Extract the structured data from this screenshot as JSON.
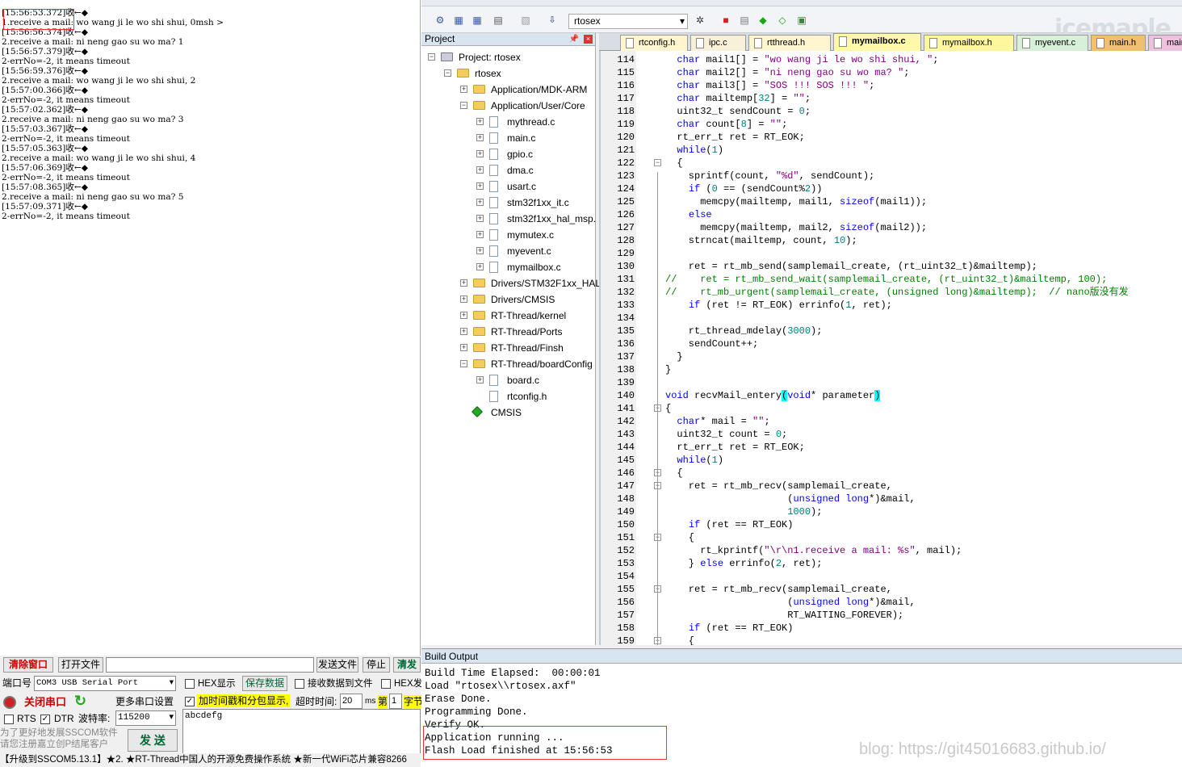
{
  "sscom": {
    "recv_lines": [
      "[15:56:53.372]收←◆",
      "1.receive a mail: wo wang ji le wo shi shui, 0msh >",
      "[15:56:56.374]收←◆",
      "2.receive a mail: ni neng gao su wo ma? 1",
      "[15:56:57.379]收←◆",
      "2-errNo=-2, it means timeout",
      "[15:56:59.376]收←◆",
      "2.receive a mail: wo wang ji le wo shi shui, 2",
      "[15:57:00.366]收←◆",
      "2-errNo=-2, it means timeout",
      "[15:57:02.362]收←◆",
      "2.receive a mail: ni neng gao su wo ma? 3",
      "[15:57:03.367]收←◆",
      "2-errNo=-2, it means timeout",
      "[15:57:05.363]收←◆",
      "2.receive a mail: wo wang ji le wo shi shui, 4",
      "[15:57:06.369]收←◆",
      "2-errNo=-2, it means timeout",
      "[15:57:08.365]收←◆",
      "2.receive a mail: ni neng gao su wo ma? 5",
      "[15:57:09.371]收←◆",
      "2-errNo=-2, it means timeout"
    ],
    "clear_btn": "清除窗口",
    "open_file_btn": "打开文件",
    "send_file_btn": "发送文件",
    "stop_btn": "停止",
    "clear_send_btn": "清发",
    "port_label": "端口号",
    "port_value": "COM3 USB Serial Port",
    "hex_show": "HEX显示",
    "save_data": "保存数据",
    "recv_to_file": "接收数据到文件",
    "hex_send": "HEX发",
    "close_port": "关闭串口",
    "more_settings": "更多串口设置",
    "timestamp_opt": "加时间戳和分包显示,",
    "timeout_label": "超时时间:",
    "timeout_value": "20",
    "timeout_unit": "ms",
    "nth_label": "第",
    "nth_value": "1",
    "byte_label": "字节",
    "rts": "RTS",
    "dtr": "DTR",
    "baud_label": "波特率:",
    "baud_value": "115200",
    "send_text": "abcdefg",
    "promo1": "为了更好地发展SSCOM软件",
    "promo2": "请您注册嘉立创P结尾客户",
    "send_btn": "发 送",
    "ticker": "【升级到SSCOM5.13.1】★2. ★RT-Thread中国人的开源免费操作系统 ★新一代WiFi芯片兼容8266"
  },
  "keil": {
    "target": "rtosex",
    "brand": "icemaple",
    "project_title": "Project",
    "tree": [
      {
        "label": "Project: rtosex",
        "level": 0,
        "kind": "root"
      },
      {
        "label": "rtosex",
        "level": 1,
        "kind": "target"
      },
      {
        "label": "Application/MDK-ARM",
        "level": 2,
        "kind": "folder",
        "state": "+"
      },
      {
        "label": "Application/User/Core",
        "level": 2,
        "kind": "folder",
        "state": "-"
      },
      {
        "label": "mythread.c",
        "level": 3,
        "kind": "file",
        "state": "+"
      },
      {
        "label": "main.c",
        "level": 3,
        "kind": "file",
        "state": "+"
      },
      {
        "label": "gpio.c",
        "level": 3,
        "kind": "file",
        "state": "+"
      },
      {
        "label": "dma.c",
        "level": 3,
        "kind": "file",
        "state": "+"
      },
      {
        "label": "usart.c",
        "level": 3,
        "kind": "file",
        "state": "+"
      },
      {
        "label": "stm32f1xx_it.c",
        "level": 3,
        "kind": "file",
        "state": "+"
      },
      {
        "label": "stm32f1xx_hal_msp.",
        "level": 3,
        "kind": "file",
        "state": "+"
      },
      {
        "label": "mymutex.c",
        "level": 3,
        "kind": "file",
        "state": "+"
      },
      {
        "label": "myevent.c",
        "level": 3,
        "kind": "file",
        "state": "+"
      },
      {
        "label": "mymailbox.c",
        "level": 3,
        "kind": "file",
        "state": "+"
      },
      {
        "label": "Drivers/STM32F1xx_HAL",
        "level": 2,
        "kind": "folder",
        "state": "+"
      },
      {
        "label": "Drivers/CMSIS",
        "level": 2,
        "kind": "folder",
        "state": "+"
      },
      {
        "label": "RT-Thread/kernel",
        "level": 2,
        "kind": "folder",
        "state": "+"
      },
      {
        "label": "RT-Thread/Ports",
        "level": 2,
        "kind": "folder",
        "state": "+"
      },
      {
        "label": "RT-Thread/Finsh",
        "level": 2,
        "kind": "folder",
        "state": "+"
      },
      {
        "label": "RT-Thread/boardConfig",
        "level": 2,
        "kind": "folder",
        "state": "-"
      },
      {
        "label": "board.c",
        "level": 3,
        "kind": "file",
        "state": "+"
      },
      {
        "label": "rtconfig.h",
        "level": 3,
        "kind": "file",
        "state": ""
      },
      {
        "label": "CMSIS",
        "level": 2,
        "kind": "component",
        "state": ""
      }
    ],
    "tabs": [
      {
        "label": "rtconfig.h",
        "color": "#fff6d0",
        "active": false
      },
      {
        "label": "ipc.c",
        "color": "#f8f0d8",
        "active": false
      },
      {
        "label": "rtthread.h",
        "color": "#fff6d0",
        "active": false
      },
      {
        "label": "mymailbox.c",
        "color": "#fff8a8",
        "active": true
      },
      {
        "label": "mymailbox.h",
        "color": "#fff6a0",
        "active": false
      },
      {
        "label": "myevent.c",
        "color": "#d8f0d8",
        "active": false
      },
      {
        "label": "main.h",
        "color": "#f0c070",
        "active": false
      },
      {
        "label": "main.c",
        "color": "#f0c0e0",
        "active": false
      }
    ],
    "code_lines": [
      {
        "n": "114",
        "t": "  char mail1[] = \"wo wang ji le wo shi shui, \";"
      },
      {
        "n": "115",
        "t": "  char mail2[] = \"ni neng gao su wo ma? \";"
      },
      {
        "n": "116",
        "t": "  char mail3[] = \"SOS !!! SOS !!! \";"
      },
      {
        "n": "117",
        "t": "  char mailtemp[32] = \"\";"
      },
      {
        "n": "118",
        "t": "  uint32_t sendCount = 0;"
      },
      {
        "n": "119",
        "t": "  char count[8] = \"\";"
      },
      {
        "n": "120",
        "t": "  rt_err_t ret = RT_EOK;"
      },
      {
        "n": "121",
        "t": "  while(1)"
      },
      {
        "n": "122",
        "t": "  {"
      },
      {
        "n": "123",
        "t": "    sprintf(count, \"%d\", sendCount);"
      },
      {
        "n": "124",
        "t": "    if (0 == (sendCount%2))"
      },
      {
        "n": "125",
        "t": "      memcpy(mailtemp, mail1, sizeof(mail1));"
      },
      {
        "n": "126",
        "t": "    else"
      },
      {
        "n": "127",
        "t": "      memcpy(mailtemp, mail2, sizeof(mail2));"
      },
      {
        "n": "128",
        "t": "    strncat(mailtemp, count, 10);"
      },
      {
        "n": "129",
        "t": ""
      },
      {
        "n": "130",
        "t": "    ret = rt_mb_send(samplemail_create, (rt_uint32_t)&mailtemp);"
      },
      {
        "n": "131",
        "t": "//    ret = rt_mb_send_wait(samplemail_create, (rt_uint32_t)&mailtemp, 100);"
      },
      {
        "n": "132",
        "t": "//    rt_mb_urgent(samplemail_create, (unsigned long)&mailtemp);  // nano版没有发"
      },
      {
        "n": "133",
        "t": "    if (ret != RT_EOK) errinfo(1, ret);"
      },
      {
        "n": "134",
        "t": ""
      },
      {
        "n": "135",
        "t": "    rt_thread_mdelay(3000);"
      },
      {
        "n": "136",
        "t": "    sendCount++;"
      },
      {
        "n": "137",
        "t": "  }"
      },
      {
        "n": "138",
        "t": "}"
      },
      {
        "n": "139",
        "t": ""
      },
      {
        "n": "140",
        "t": "void recvMail_entery(void* parameter)"
      },
      {
        "n": "141",
        "t": "{"
      },
      {
        "n": "142",
        "t": "  char* mail = \"\";"
      },
      {
        "n": "143",
        "t": "  uint32_t count = 0;"
      },
      {
        "n": "144",
        "t": "  rt_err_t ret = RT_EOK;"
      },
      {
        "n": "145",
        "t": "  while(1)"
      },
      {
        "n": "146",
        "t": "  {"
      },
      {
        "n": "147",
        "t": "    ret = rt_mb_recv(samplemail_create,"
      },
      {
        "n": "148",
        "t": "                     (unsigned long*)&mail,"
      },
      {
        "n": "149",
        "t": "                     1000);"
      },
      {
        "n": "150",
        "t": "    if (ret == RT_EOK)"
      },
      {
        "n": "151",
        "t": "    {"
      },
      {
        "n": "152",
        "t": "      rt_kprintf(\"\\r\\n1.receive a mail: %s\", mail);"
      },
      {
        "n": "153",
        "t": "    } else errinfo(2, ret);"
      },
      {
        "n": "154",
        "t": ""
      },
      {
        "n": "155",
        "t": "    ret = rt_mb_recv(samplemail_create,"
      },
      {
        "n": "156",
        "t": "                     (unsigned long*)&mail,"
      },
      {
        "n": "157",
        "t": "                     RT_WAITING_FOREVER);"
      },
      {
        "n": "158",
        "t": "    if (ret == RT_EOK)"
      },
      {
        "n": "159",
        "t": "    {"
      }
    ],
    "build_title": "Build Output",
    "build_lines": [
      "Build Time Elapsed:  00:00:01",
      "Load \"rtosex\\\\rtosex.axf\"",
      "Erase Done.",
      "Programming Done.",
      "Verify OK.",
      "Application running ...",
      "Flash Load finished at 15:56:53"
    ],
    "watermark": "blog: https://git45016683.github.io/"
  }
}
